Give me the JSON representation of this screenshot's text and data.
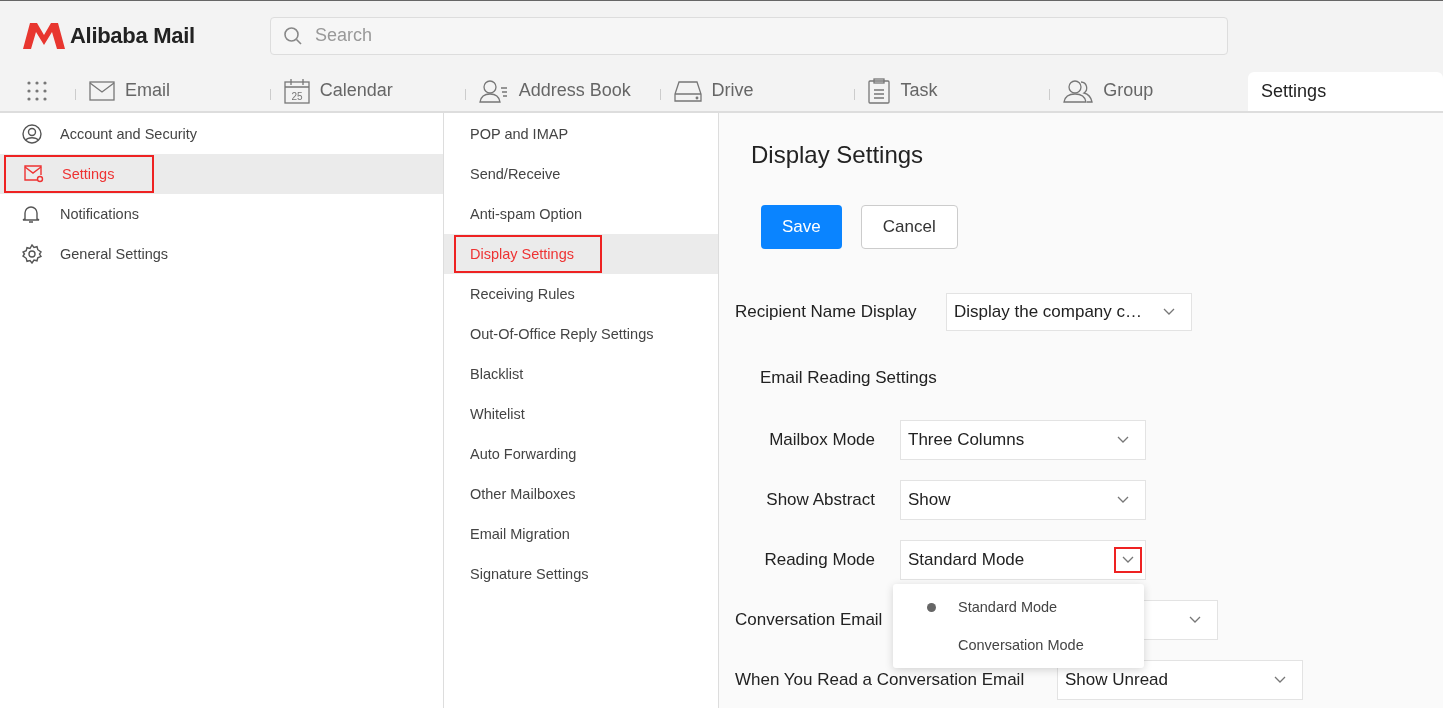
{
  "header": {
    "logo": "Alibaba Mail",
    "search": {
      "placeholder": "Search"
    }
  },
  "nav_tabs": [
    {
      "label": "Email",
      "selected": false
    },
    {
      "label": "Calendar",
      "icon_text": "25",
      "selected": false
    },
    {
      "label": "Address Book",
      "selected": false
    },
    {
      "label": "Drive",
      "selected": false
    },
    {
      "label": "Task",
      "selected": false
    },
    {
      "label": "Group",
      "selected": false
    },
    {
      "label": "Settings",
      "selected": true
    }
  ],
  "sidebar": {
    "items": [
      {
        "label": "Account and Security",
        "selected": false
      },
      {
        "label": "Settings",
        "selected": true
      },
      {
        "label": "Notifications",
        "selected": false
      },
      {
        "label": "General Settings",
        "selected": false
      }
    ]
  },
  "submenu": {
    "items": [
      {
        "label": "POP and IMAP",
        "selected": false
      },
      {
        "label": "Send/Receive",
        "selected": false
      },
      {
        "label": "Anti-spam Option",
        "selected": false
      },
      {
        "label": "Display Settings",
        "selected": true
      },
      {
        "label": "Receiving Rules",
        "selected": false
      },
      {
        "label": "Out-Of-Office Reply Settings",
        "selected": false
      },
      {
        "label": "Blacklist",
        "selected": false
      },
      {
        "label": "Whitelist",
        "selected": false
      },
      {
        "label": "Auto Forwarding",
        "selected": false
      },
      {
        "label": "Other Mailboxes",
        "selected": false
      },
      {
        "label": "Email Migration",
        "selected": false
      },
      {
        "label": "Signature Settings",
        "selected": false
      }
    ]
  },
  "content": {
    "title": "Display Settings",
    "buttons": [
      {
        "label": "Save",
        "kind": "primary"
      },
      {
        "label": "Cancel",
        "kind": "default"
      }
    ],
    "rows": [
      {
        "kind": "primary",
        "label": "Recipient Name Display",
        "value": "Display the company c…",
        "highlighted": false
      },
      {
        "kind": "heading",
        "label": "Email Reading Settings"
      },
      {
        "kind": "sub",
        "label": "Mailbox Mode",
        "value": "Three Columns",
        "highlighted": false
      },
      {
        "kind": "sub",
        "label": "Show Abstract",
        "value": "Show",
        "highlighted": false
      },
      {
        "kind": "sub",
        "label": "Reading Mode",
        "value": "Standard Mode",
        "highlighted": true,
        "open": true,
        "options": [
          {
            "label": "Standard Mode",
            "selected": true
          },
          {
            "label": "Conversation Mode",
            "selected": false
          }
        ]
      },
      {
        "kind": "conv",
        "label": "Conversation Email",
        "highlighted": false
      },
      {
        "kind": "read",
        "label": "When You Read a Conversation Email",
        "value": "Show Unread",
        "highlighted": false
      }
    ]
  }
}
